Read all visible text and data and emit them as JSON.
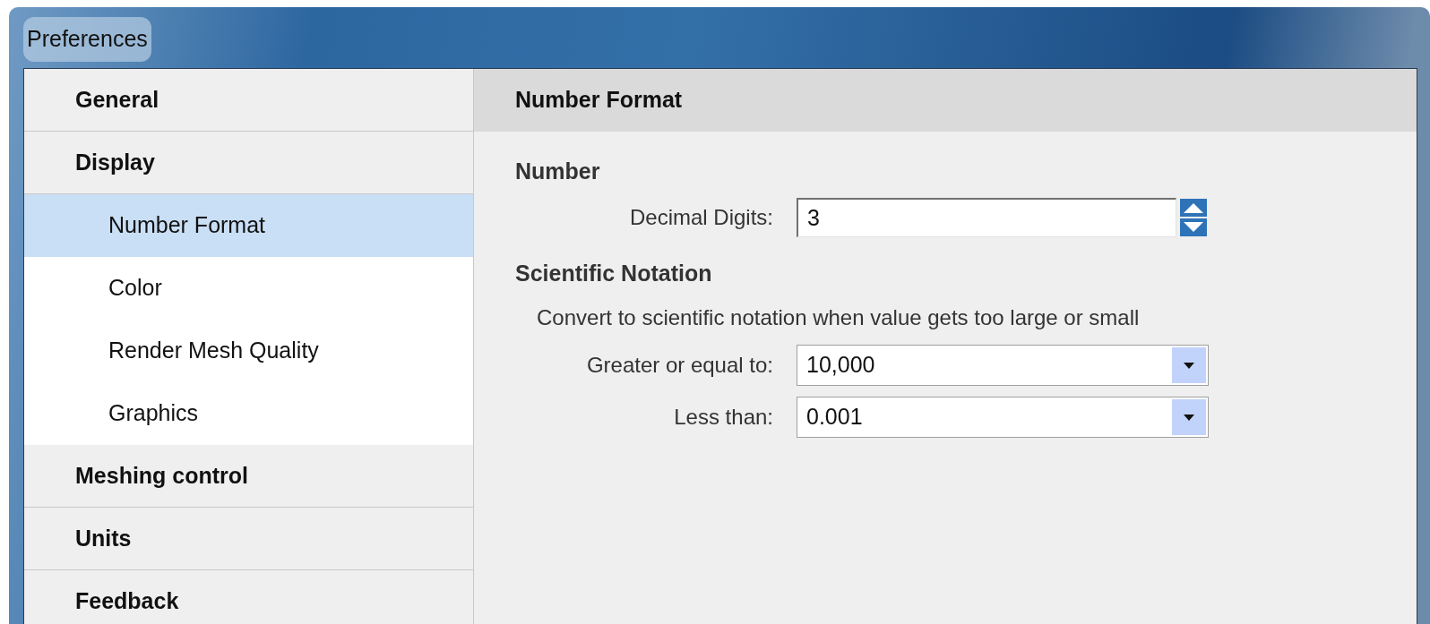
{
  "window": {
    "title": "Preferences"
  },
  "sidebar": {
    "items": [
      {
        "label": "General",
        "selected": false
      },
      {
        "label": "Display",
        "selected": false,
        "children": [
          {
            "label": "Number Format",
            "selected": true
          },
          {
            "label": "Color",
            "selected": false
          },
          {
            "label": "Render Mesh Quality",
            "selected": false
          },
          {
            "label": "Graphics",
            "selected": false
          }
        ]
      },
      {
        "label": "Meshing control",
        "selected": false
      },
      {
        "label": "Units",
        "selected": false
      },
      {
        "label": "Feedback",
        "selected": false
      }
    ]
  },
  "panel": {
    "title": "Number Format",
    "sections": [
      {
        "heading": "Number",
        "fields": [
          {
            "kind": "spinner",
            "label": "Decimal Digits:",
            "value": "3"
          }
        ]
      },
      {
        "heading": "Scientific Notation",
        "description": "Convert to scientific notation when value gets too large or small",
        "fields": [
          {
            "kind": "dropdown",
            "label": "Greater or equal to:",
            "value": "10,000"
          },
          {
            "kind": "dropdown",
            "label": "Less than:",
            "value": "0.001"
          }
        ]
      }
    ]
  }
}
